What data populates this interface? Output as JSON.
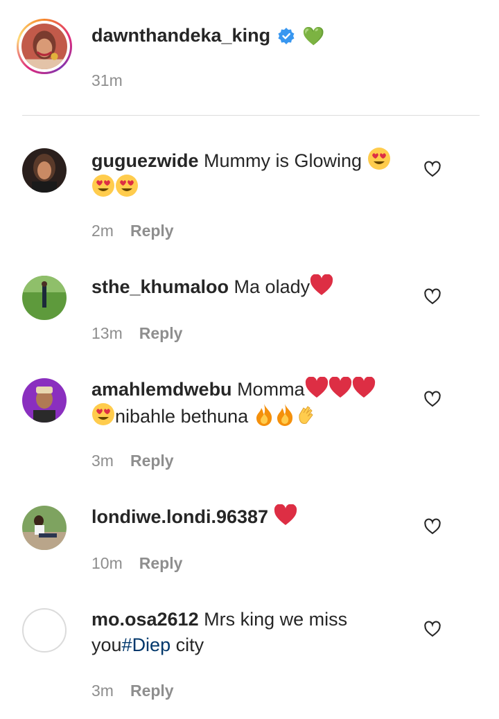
{
  "post": {
    "username": "dawnthandeka_king",
    "badge_emoji": "💚",
    "time": "31m"
  },
  "comments": [
    {
      "username": "guguezwide",
      "text_line1": " Mummy is Glowing ",
      "time": "2m",
      "reply": "Reply"
    },
    {
      "username": "sthe_khumaloo",
      "text_line1": " Ma olady",
      "time": "13m",
      "reply": "Reply"
    },
    {
      "username": "amahlemdwebu",
      "text_line1": " Momma",
      "text_line2": "nibahle bethuna",
      "time": "3m",
      "reply": "Reply"
    },
    {
      "username": "londiwe.londi.96387",
      "text_line1": " ",
      "time": "10m",
      "reply": "Reply"
    },
    {
      "username": "mo.osa2612",
      "text_line1": " Mrs king we miss",
      "text_line2": "you",
      "hashtag": "#Diep",
      "text_line2_end": " city",
      "time": "3m",
      "reply": "Reply"
    }
  ],
  "colors": {
    "text": "#262626",
    "muted": "#8e8e8e",
    "link": "#00376b",
    "verified": "#3897f0"
  }
}
